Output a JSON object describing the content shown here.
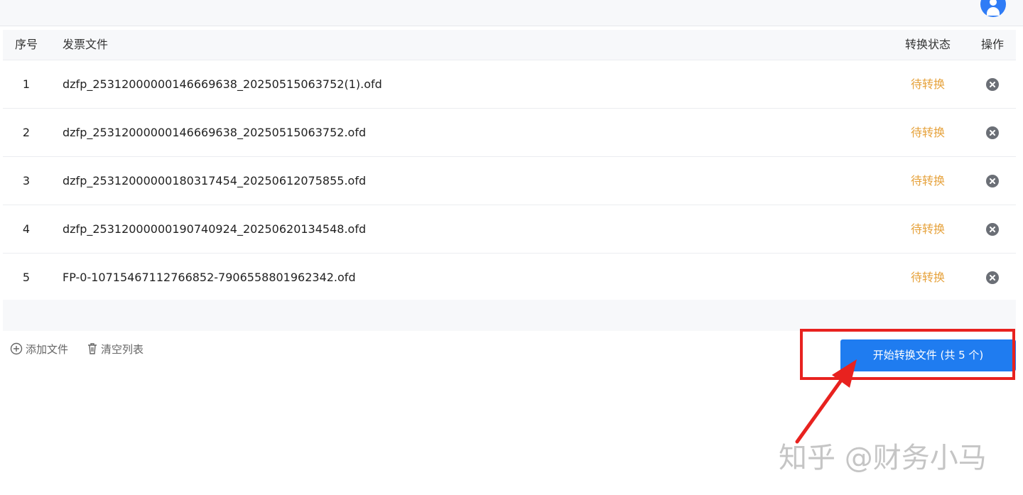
{
  "header": {
    "avatar_icon": "user-icon"
  },
  "table": {
    "columns": {
      "index": "序号",
      "file": "发票文件",
      "status": "转换状态",
      "action": "操作"
    },
    "rows": [
      {
        "index": "1",
        "file": "dzfp_25312000000146669638_20250515063752(1).ofd",
        "status": "待转换"
      },
      {
        "index": "2",
        "file": "dzfp_25312000000146669638_20250515063752.ofd",
        "status": "待转换"
      },
      {
        "index": "3",
        "file": "dzfp_25312000000180317454_20250612075855.ofd",
        "status": "待转换"
      },
      {
        "index": "4",
        "file": "dzfp_25312000000190740924_20250620134548.ofd",
        "status": "待转换"
      },
      {
        "index": "5",
        "file": "FP-0-10715467112766852-7906558801962342.ofd",
        "status": "待转换"
      }
    ]
  },
  "actions": {
    "add_files": "添加文件",
    "clear_list": "清空列表"
  },
  "start_button": "开始转换文件 (共 5 个)",
  "watermark": "知乎 @财务小马",
  "colors": {
    "primary": "#1f7cf0",
    "pending": "#e6a23c",
    "highlight": "#e8221f"
  }
}
